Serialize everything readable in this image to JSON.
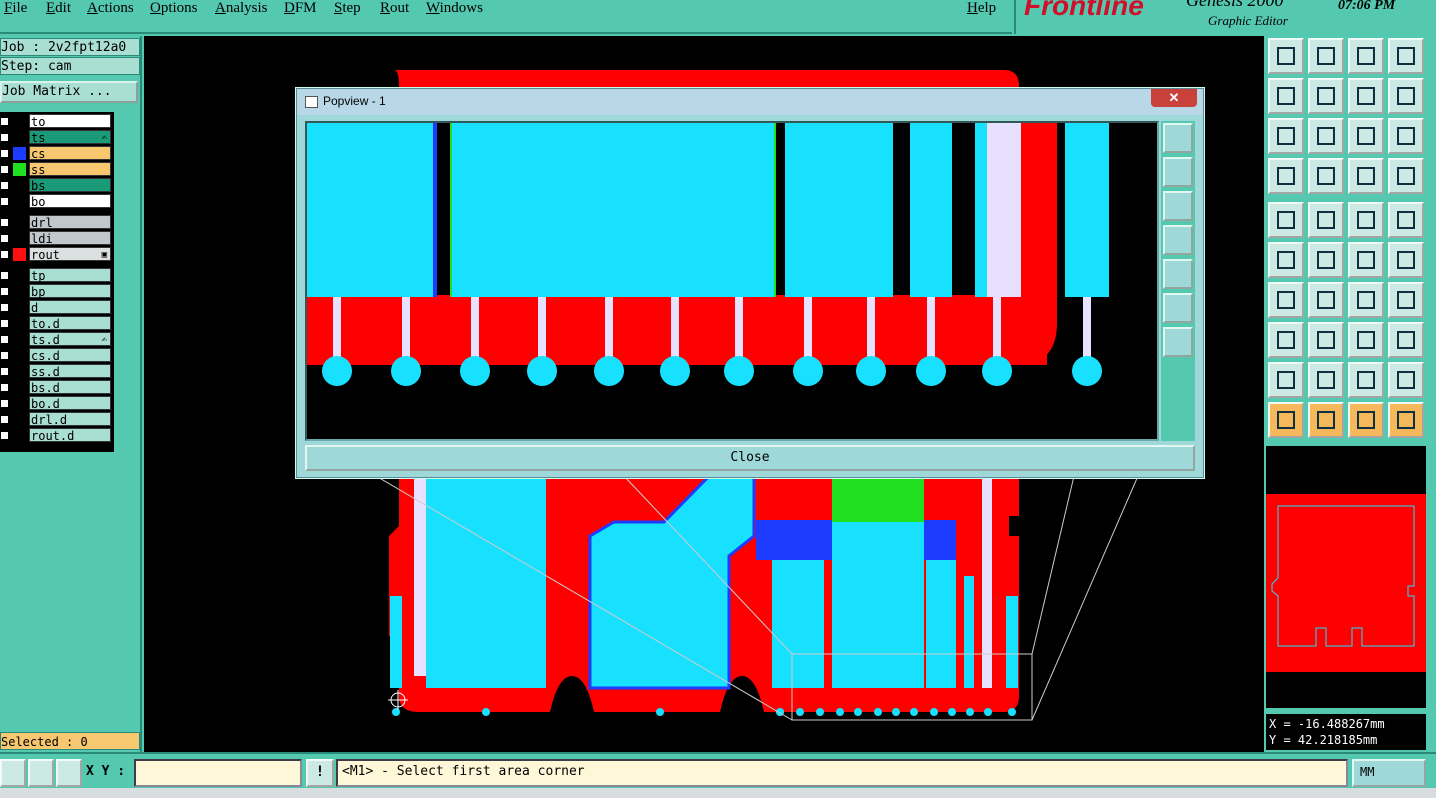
{
  "menu": {
    "items": [
      "File",
      "Edit",
      "Actions",
      "Options",
      "Analysis",
      "DFM",
      "Step",
      "Rout",
      "Windows"
    ],
    "help": "Help"
  },
  "brand": {
    "logo": "Frontline",
    "product": "Genesis 2000",
    "subtitle": "Graphic Editor",
    "time": "07:06 PM"
  },
  "job": {
    "job_line": "Job : 2v2fpt12a0",
    "step_line": "Step: cam",
    "matrix_button": "Job Matrix ..."
  },
  "layers": [
    {
      "name": "to",
      "swatch": "#000000",
      "bg": "#ffffff",
      "mark": ""
    },
    {
      "name": "ts",
      "swatch": "#000000",
      "bg": "#1a9a78",
      "mark": "✍"
    },
    {
      "name": "cs",
      "swatch": "#1e3cff",
      "bg": "#f8c870",
      "mark": ""
    },
    {
      "name": "ss",
      "swatch": "#20e020",
      "bg": "#f8c870",
      "mark": ""
    },
    {
      "name": "bs",
      "swatch": "#000000",
      "bg": "#1a9a78",
      "mark": ""
    },
    {
      "name": "bo",
      "swatch": "#000000",
      "bg": "#ffffff",
      "mark": ""
    },
    {
      "name": "drl",
      "swatch": "#000000",
      "bg": "#c0c8cc",
      "mark": ""
    },
    {
      "name": "ldi",
      "swatch": "#000000",
      "bg": "#c0c8cc",
      "mark": ""
    },
    {
      "name": "rout",
      "swatch": "#ff1010",
      "bg": "#dde0e0",
      "mark": "▣"
    },
    {
      "name": "tp",
      "swatch": "#000000",
      "bg": "#a9ded2",
      "mark": ""
    },
    {
      "name": "bp",
      "swatch": "#000000",
      "bg": "#a9ded2",
      "mark": ""
    },
    {
      "name": "d",
      "swatch": "#000000",
      "bg": "#a9ded2",
      "mark": ""
    },
    {
      "name": "to.d",
      "swatch": "#000000",
      "bg": "#a9ded2",
      "mark": ""
    },
    {
      "name": "ts.d",
      "swatch": "#000000",
      "bg": "#a9ded2",
      "mark": "✍"
    },
    {
      "name": "cs.d",
      "swatch": "#000000",
      "bg": "#a9ded2",
      "mark": ""
    },
    {
      "name": "ss.d",
      "swatch": "#000000",
      "bg": "#a9ded2",
      "mark": ""
    },
    {
      "name": "bs.d",
      "swatch": "#000000",
      "bg": "#a9ded2",
      "mark": ""
    },
    {
      "name": "bo.d",
      "swatch": "#000000",
      "bg": "#a9ded2",
      "mark": ""
    },
    {
      "name": "drl.d",
      "swatch": "#000000",
      "bg": "#a9ded2",
      "mark": ""
    },
    {
      "name": "rout.d",
      "swatch": "#000000",
      "bg": "#a9ded2",
      "mark": ""
    }
  ],
  "selected": "Selected : 0",
  "popview": {
    "title": "Popview - 1",
    "close_x": "✕",
    "close_button": "Close"
  },
  "coords": {
    "x": "X = -16.488267mm",
    "y": "Y = 42.218185mm"
  },
  "bottom": {
    "xy_label": "X Y :",
    "xy_value": "",
    "info_button": "!",
    "status": "<M1> - Select first area corner",
    "units": "MM"
  },
  "colors": {
    "panel": "#55c8b0",
    "copper": "#18e0ff",
    "rout": "#ff0000",
    "mask": "#e8e0ff"
  }
}
